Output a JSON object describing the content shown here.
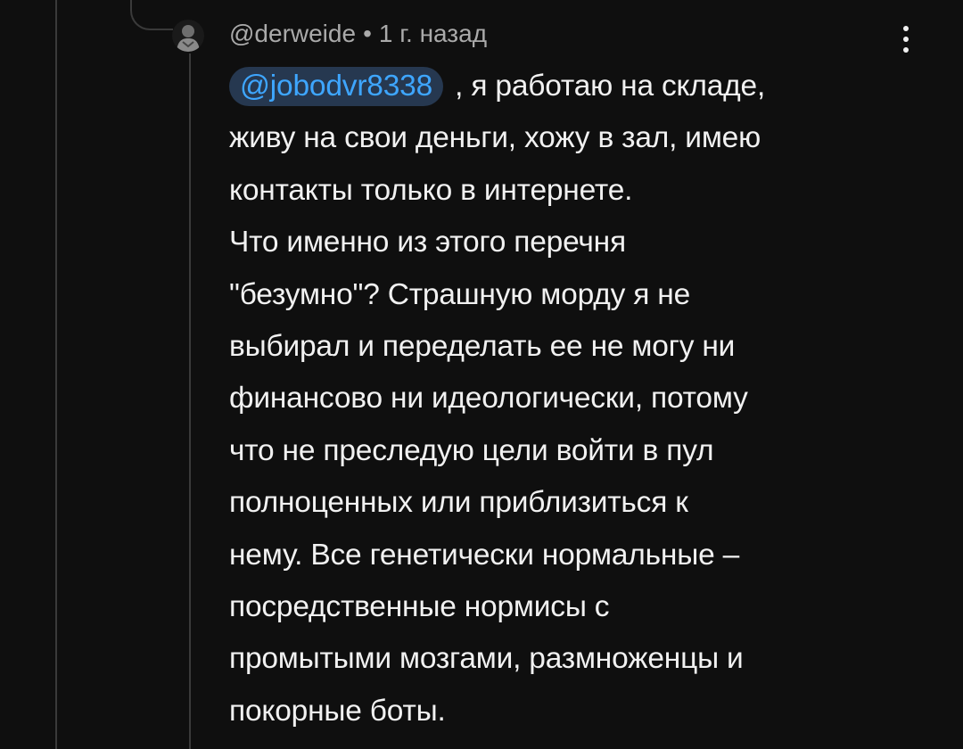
{
  "comment": {
    "author": "@derweide",
    "separator": "•",
    "time": "1 г. назад",
    "mention": "@jobodvr8338",
    "lines": [
      " , я работаю на складе,",
      "живу на свои деньги, хожу в зал, имею",
      "контакты только в интернете.",
      "Что именно из этого перечня",
      "\"безумно\"? Страшную морду я не",
      "выбирал и переделать ее не могу ни",
      "финансово ни идеологически, потому",
      "что не преследую цели войти в пул",
      "полноценных или приблизиться к",
      "нему. Все генетически нормальные –",
      "посредственные нормисы с",
      "промытыми мозгами, размноженцы и",
      "покорные боты."
    ]
  },
  "icons": {
    "menu": "more-vertical-icon",
    "avatar": "user-avatar"
  },
  "colors": {
    "background": "#0f0f0f",
    "text": "#f1f1f1",
    "meta": "#aaaaaa",
    "mention_text": "#3ea6ff",
    "mention_bg": "#263850",
    "thread_line": "#3a3a3a"
  }
}
